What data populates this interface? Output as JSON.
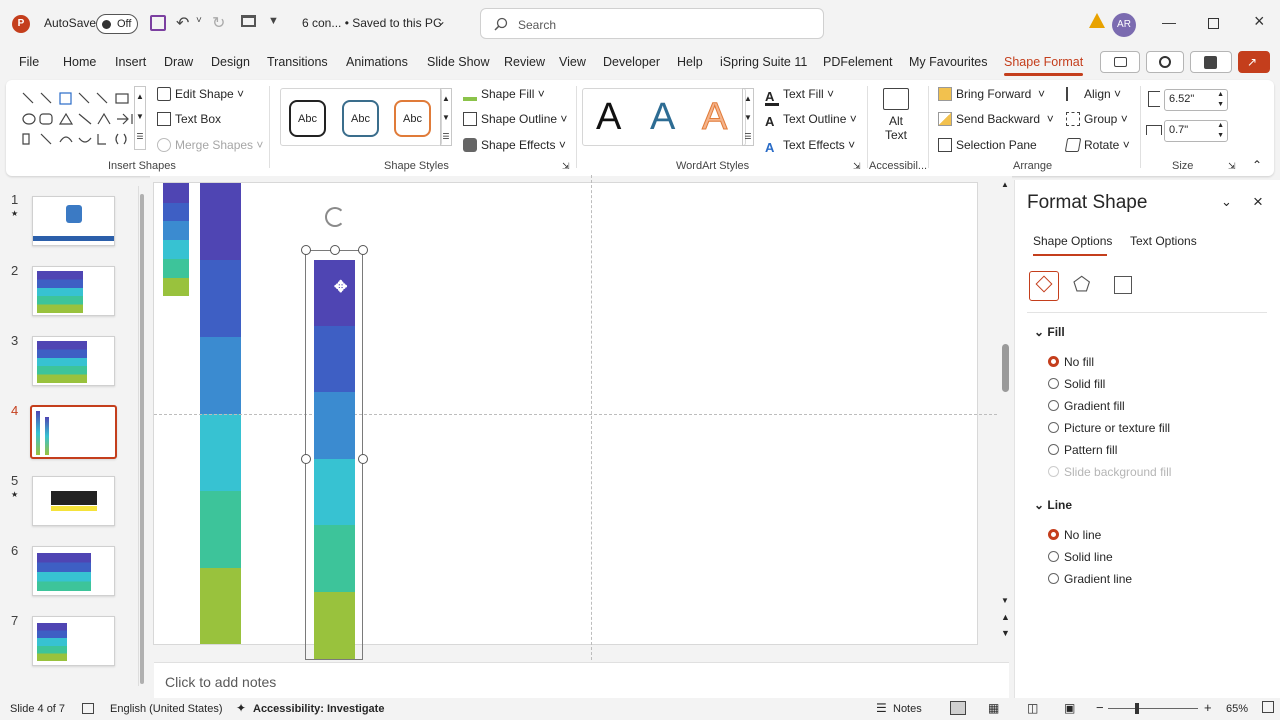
{
  "app": {
    "autosave_label": "AutoSave",
    "autosave_state": "Off",
    "doc_title": "6 con... • Saved to this PC",
    "doc_chevron": "⌄",
    "avatar": "AR"
  },
  "search": {
    "placeholder": "Search"
  },
  "tabs": [
    "File",
    "Home",
    "Insert",
    "Draw",
    "Design",
    "Transitions",
    "Animations",
    "Slide Show",
    "Review",
    "View",
    "Developer",
    "Help",
    "iSpring Suite 11",
    "PDFelement",
    "My Favourites",
    "Shape Format"
  ],
  "ribbon": {
    "insert_shapes": {
      "label": "Insert Shapes",
      "edit_shape": "Edit Shape",
      "text_box": "Text Box",
      "merge_shapes": "Merge Shapes"
    },
    "shape_styles": {
      "label": "Shape Styles",
      "sample": "Abc",
      "fill": "Shape Fill",
      "outline": "Shape Outline",
      "effects": "Shape Effects"
    },
    "wordart": {
      "label": "WordArt Styles",
      "letter": "A",
      "text_fill": "Text Fill",
      "text_outline": "Text Outline",
      "text_effects": "Text Effects"
    },
    "accessibility": {
      "label": "Accessibil...",
      "alt_text_1": "Alt",
      "alt_text_2": "Text"
    },
    "arrange": {
      "label": "Arrange",
      "bring_forward": "Bring Forward",
      "send_backward": "Send Backward",
      "selection_pane": "Selection Pane",
      "align": "Align",
      "group": "Group",
      "rotate": "Rotate"
    },
    "size": {
      "label": "Size",
      "height": "6.52\"",
      "width": "0.7\""
    }
  },
  "slides": [
    "1",
    "2",
    "3",
    "4",
    "5",
    "6",
    "7"
  ],
  "current_slide": 4,
  "notes": {
    "placeholder": "Click to add notes"
  },
  "colors": {
    "accent": "#c43e1c",
    "seg1": "#4f45b3",
    "seg2": "#3e5fc4",
    "seg3": "#3b8bd0",
    "seg4": "#37c2d2",
    "seg5": "#3dc49a",
    "seg6": "#99c23d"
  },
  "pane": {
    "title": "Format Shape",
    "tab_shape": "Shape Options",
    "tab_text": "Text Options",
    "fill_header": "Fill",
    "fill_options": [
      "No fill",
      "Solid fill",
      "Gradient fill",
      "Picture or texture fill",
      "Pattern fill",
      "Slide background fill"
    ],
    "fill_selected": "No fill",
    "line_header": "Line",
    "line_options": [
      "No line",
      "Solid line",
      "Gradient line"
    ],
    "line_selected": "No line"
  },
  "status": {
    "slide_info": "Slide 4 of 7",
    "language": "English (United States)",
    "accessibility": "Accessibility: Investigate",
    "notes": "Notes",
    "zoom": "65%"
  }
}
